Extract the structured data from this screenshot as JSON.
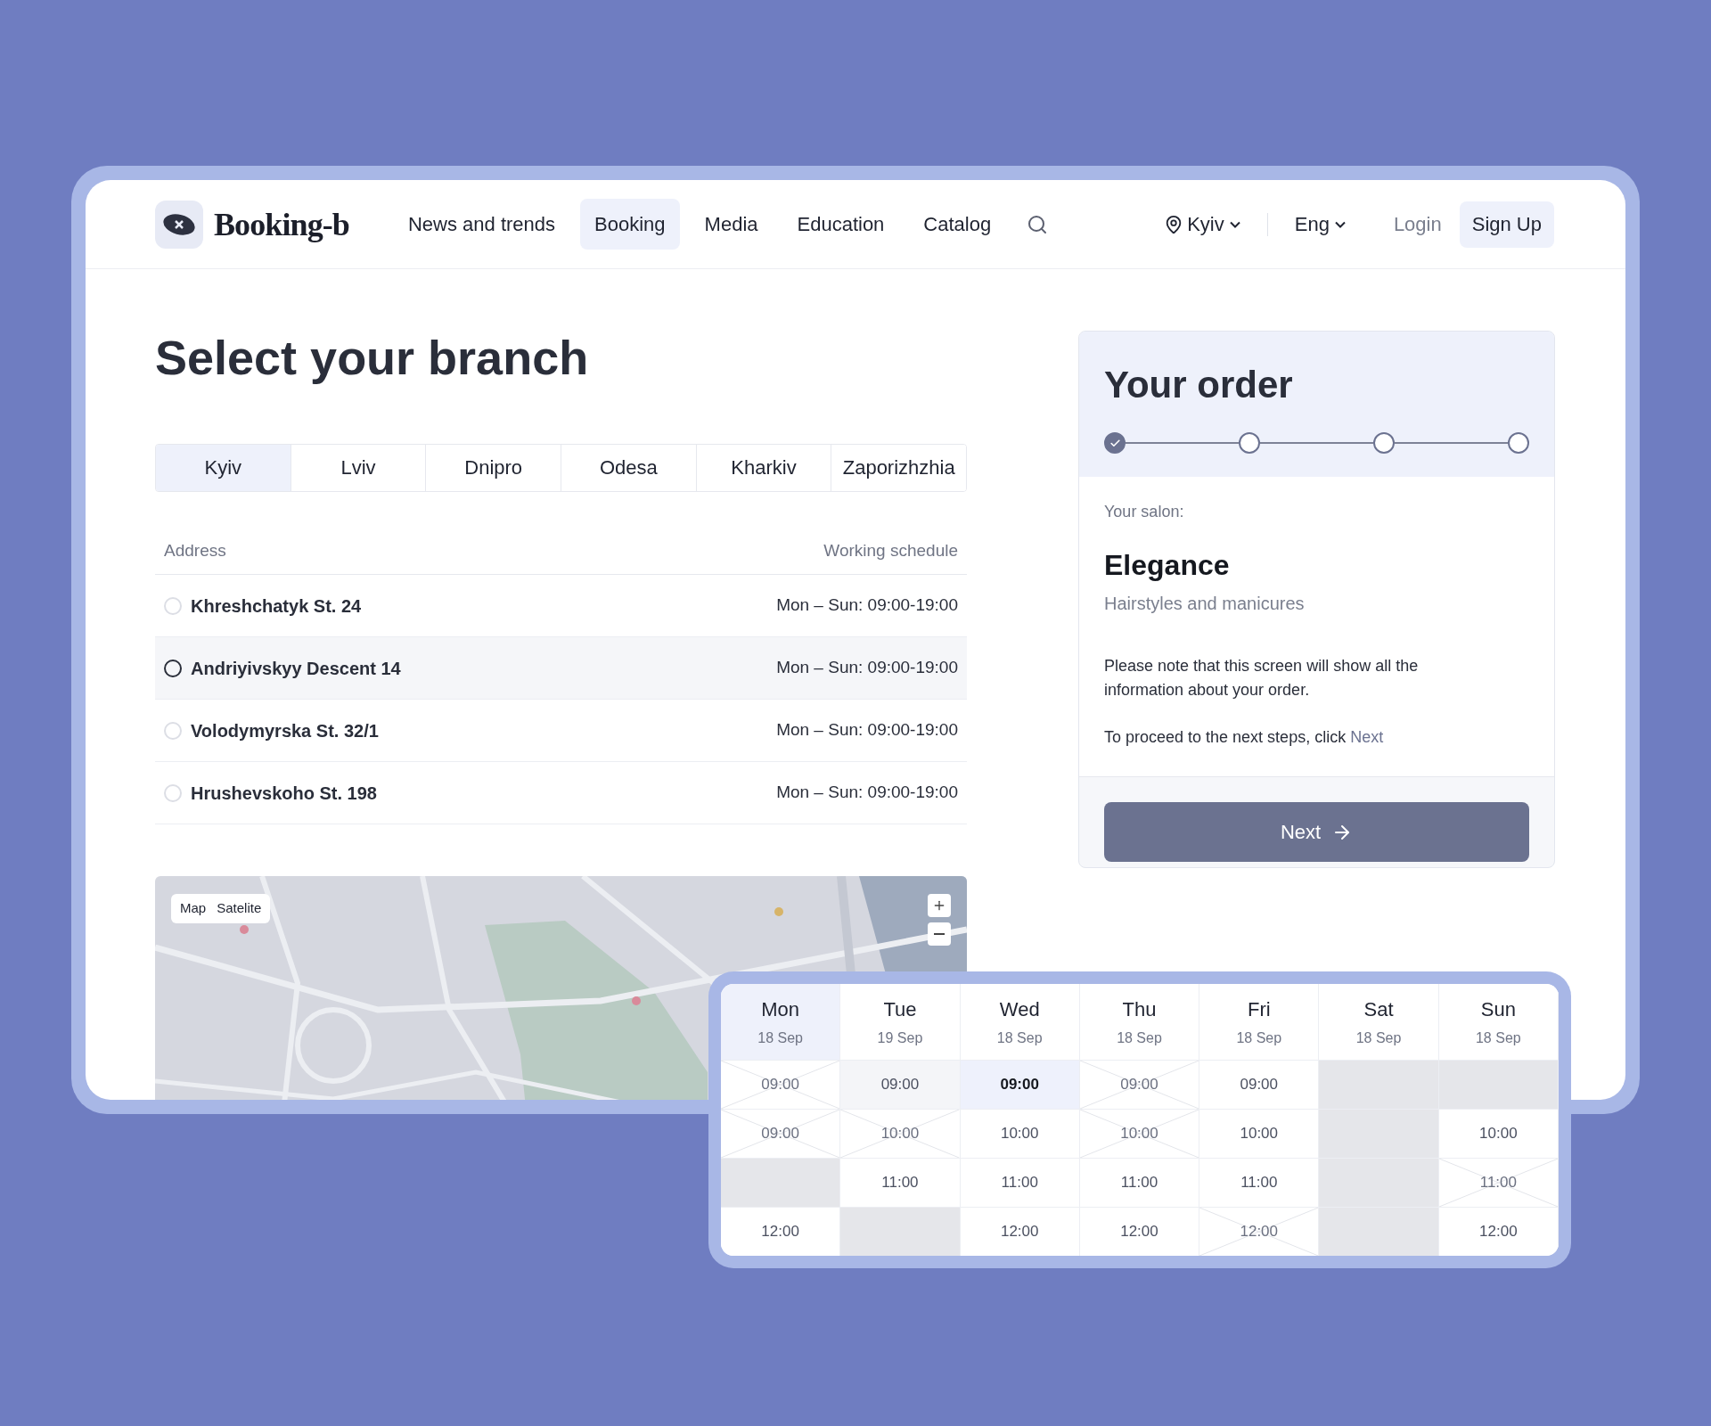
{
  "header": {
    "logo_text": "Booking-b",
    "nav": [
      {
        "label": "News and trends",
        "selected": false
      },
      {
        "label": "Booking",
        "selected": true
      },
      {
        "label": "Media",
        "selected": false
      },
      {
        "label": "Education",
        "selected": false
      },
      {
        "label": "Catalog",
        "selected": false
      }
    ],
    "city": "Kyiv",
    "language": "Eng",
    "login": "Login",
    "signup": "Sign Up"
  },
  "title": "Select your branch",
  "city_tabs": [
    {
      "label": "Kyiv",
      "selected": true
    },
    {
      "label": "Lviv",
      "selected": false
    },
    {
      "label": "Dnipro",
      "selected": false
    },
    {
      "label": "Odesa",
      "selected": false
    },
    {
      "label": "Kharkiv",
      "selected": false
    },
    {
      "label": "Zaporizhzhia",
      "selected": false
    }
  ],
  "table": {
    "columns": [
      "Address",
      "Working schedule"
    ],
    "rows": [
      {
        "address": "Khreshchatyk St. 24",
        "schedule": "Mon – Sun: 09:00-19:00",
        "selected": false
      },
      {
        "address": "Andriyivskyy Descent 14",
        "schedule": "Mon – Sun: 09:00-19:00",
        "selected": true
      },
      {
        "address": "Volodymyrska St. 32/1",
        "schedule": "Mon – Sun: 09:00-19:00",
        "selected": false
      },
      {
        "address": "Hrushevskoho St. 198",
        "schedule": "Mon – Sun: 09:00-19:00",
        "selected": false
      }
    ]
  },
  "map": {
    "modes": [
      "Map",
      "Satelite"
    ]
  },
  "order": {
    "title": "Your order",
    "steps": [
      {
        "done": true
      },
      {
        "done": false
      },
      {
        "done": false
      },
      {
        "done": false
      }
    ],
    "salon_label": "Your salon:",
    "salon_name": "Elegance",
    "salon_desc": "Hairstyles and manicures",
    "note": "Please note that this screen will show all the information about your order.",
    "proceed_text": "To proceed to the next steps, click",
    "proceed_link": "Next",
    "button": "Next"
  },
  "calendar": {
    "days": [
      {
        "day": "Mon",
        "date": "18 Sep",
        "selected": true,
        "slots": [
          {
            "time": "09:00",
            "kind": "booked"
          },
          {
            "time": "09:00",
            "kind": "booked"
          },
          {
            "kind": "closed"
          },
          {
            "time": "12:00",
            "kind": "open"
          }
        ]
      },
      {
        "day": "Tue",
        "date": "19 Sep",
        "selected": false,
        "slots": [
          {
            "time": "09:00",
            "kind": "hover"
          },
          {
            "time": "10:00",
            "kind": "booked"
          },
          {
            "time": "11:00",
            "kind": "open"
          },
          {
            "kind": "closed"
          }
        ]
      },
      {
        "day": "Wed",
        "date": "18 Sep",
        "selected": false,
        "slots": [
          {
            "time": "09:00",
            "kind": "selected"
          },
          {
            "time": "10:00",
            "kind": "open"
          },
          {
            "time": "11:00",
            "kind": "open"
          },
          {
            "time": "12:00",
            "kind": "open"
          }
        ]
      },
      {
        "day": "Thu",
        "date": "18 Sep",
        "selected": false,
        "slots": [
          {
            "time": "09:00",
            "kind": "booked"
          },
          {
            "time": "10:00",
            "kind": "booked"
          },
          {
            "time": "11:00",
            "kind": "open"
          },
          {
            "time": "12:00",
            "kind": "open"
          }
        ]
      },
      {
        "day": "Fri",
        "date": "18 Sep",
        "selected": false,
        "slots": [
          {
            "time": "09:00",
            "kind": "open"
          },
          {
            "time": "10:00",
            "kind": "open"
          },
          {
            "time": "11:00",
            "kind": "open"
          },
          {
            "time": "12:00",
            "kind": "booked"
          }
        ]
      },
      {
        "day": "Sat",
        "date": "18 Sep",
        "selected": false,
        "slots": [
          {
            "kind": "closed"
          },
          {
            "kind": "closed"
          },
          {
            "kind": "closed"
          },
          {
            "kind": "closed"
          }
        ]
      },
      {
        "day": "Sun",
        "date": "18 Sep",
        "selected": false,
        "slots": [
          {
            "kind": "closed"
          },
          {
            "time": "10:00",
            "kind": "open"
          },
          {
            "time": "11:00",
            "kind": "booked"
          },
          {
            "time": "12:00",
            "kind": "open"
          }
        ]
      }
    ]
  }
}
